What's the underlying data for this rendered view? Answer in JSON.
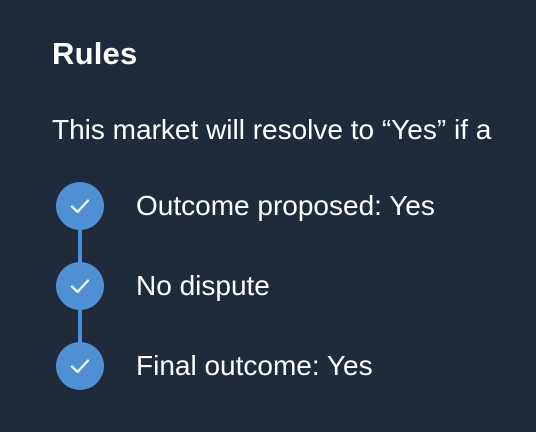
{
  "rules": {
    "title": "Rules",
    "description": "This market will resolve to “Yes” if a",
    "steps": [
      {
        "label": "Outcome proposed: Yes",
        "status": "completed",
        "icon": "check-icon"
      },
      {
        "label": "No dispute",
        "status": "completed",
        "icon": "check-icon"
      },
      {
        "label": "Final outcome: Yes",
        "status": "completed",
        "icon": "check-icon"
      }
    ]
  },
  "colors": {
    "background": "#1f2a3a",
    "accent": "#4f8fd4",
    "text": "#ffffff"
  }
}
